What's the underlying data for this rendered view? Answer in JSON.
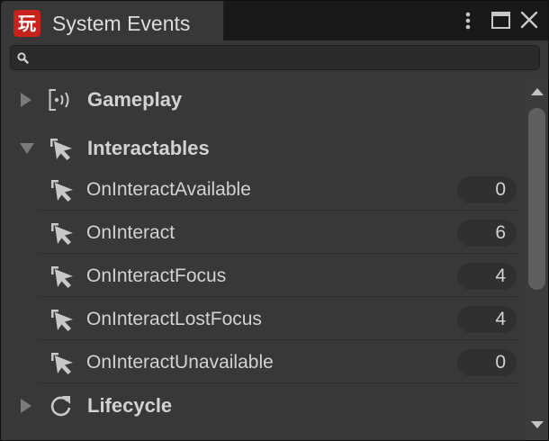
{
  "window": {
    "tab_title": "System Events",
    "icon_glyph": "玩",
    "accent_color": "#c8221c"
  },
  "search": {
    "placeholder": "",
    "value": ""
  },
  "tree": [
    {
      "type": "group",
      "label": "Gameplay",
      "icon": "broadcast-icon",
      "expanded": false
    },
    {
      "type": "group",
      "label": "Interactables",
      "icon": "interact-cursor-icon",
      "expanded": true
    },
    {
      "type": "item",
      "label": "OnInteractAvailable",
      "icon": "interact-cursor-icon",
      "count": "0"
    },
    {
      "type": "item",
      "label": "OnInteract",
      "icon": "interact-cursor-icon",
      "count": "6"
    },
    {
      "type": "item",
      "label": "OnInteractFocus",
      "icon": "interact-cursor-icon",
      "count": "4"
    },
    {
      "type": "item",
      "label": "OnInteractLostFocus",
      "icon": "interact-cursor-icon",
      "count": "4"
    },
    {
      "type": "item",
      "label": "OnInteractUnavailable",
      "icon": "interact-cursor-icon",
      "count": "0"
    },
    {
      "type": "group",
      "label": "Lifecycle",
      "icon": "refresh-icon",
      "expanded": false
    }
  ],
  "scroll": {
    "thumb_fraction": 0.55,
    "position": 0
  }
}
